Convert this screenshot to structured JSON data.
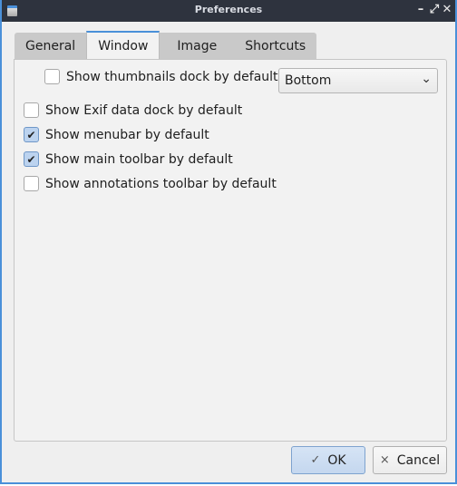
{
  "window": {
    "title": "Preferences",
    "controls": {
      "minimize": "–",
      "maximize": "⤢",
      "close": "✕"
    }
  },
  "tabs": [
    {
      "label": "General",
      "active": false
    },
    {
      "label": "Window",
      "active": true
    },
    {
      "label": "Image",
      "active": false
    },
    {
      "label": "Shortcuts",
      "active": false
    }
  ],
  "options": {
    "thumbnails": {
      "label": "Show thumbnails dock by default",
      "checked": false
    },
    "thumbnails_position": {
      "value": "Bottom"
    },
    "exif": {
      "label": "Show Exif data dock by default",
      "checked": false
    },
    "menubar": {
      "label": "Show menubar by default",
      "checked": true
    },
    "main_toolbar": {
      "label": "Show main toolbar by default",
      "checked": true
    },
    "annotations_toolbar": {
      "label": "Show annotations toolbar by default",
      "checked": false
    }
  },
  "buttons": {
    "ok": "OK",
    "cancel": "Cancel",
    "ok_icon": "✓",
    "cancel_icon": "×"
  },
  "colors": {
    "accent": "#4a90d9",
    "titlebar": "#2e333e"
  }
}
